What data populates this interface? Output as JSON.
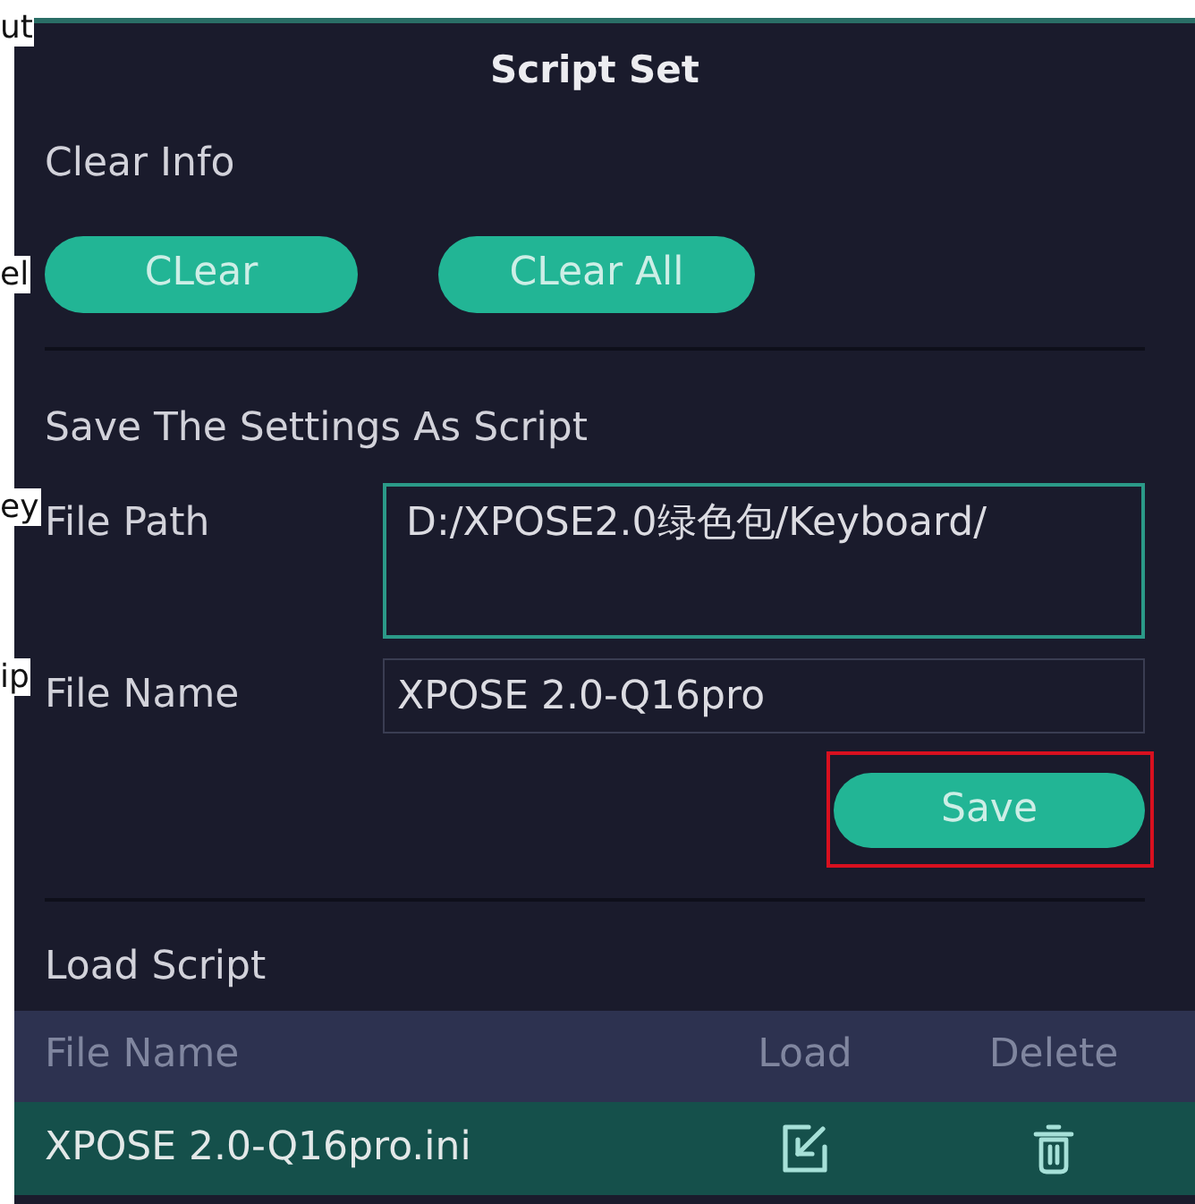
{
  "background_fragments": [
    "ut",
    "el",
    "ey",
    "ip"
  ],
  "window": {
    "title": "Script Set"
  },
  "clear_section": {
    "heading": "Clear Info",
    "buttons": [
      "CLear",
      "CLear All"
    ]
  },
  "save_section": {
    "heading": "Save The Settings As Script",
    "fields": [
      {
        "label": "File Path",
        "value": "D:/XPOSE2.0绿色包/Keyboard/",
        "kind": "multiline",
        "focused": true
      },
      {
        "label": "File Name",
        "value": "XPOSE 2.0-Q16pro",
        "kind": "single",
        "focused": false
      }
    ],
    "save_button": {
      "label": "Save",
      "highlighted": true
    }
  },
  "load_section": {
    "heading": "Load Script",
    "table": {
      "columns": [
        "File Name",
        "Load",
        "Delete"
      ],
      "rows": [
        {
          "file_name": "XPOSE 2.0-Q16pro.ini",
          "selected": true
        }
      ]
    }
  }
}
